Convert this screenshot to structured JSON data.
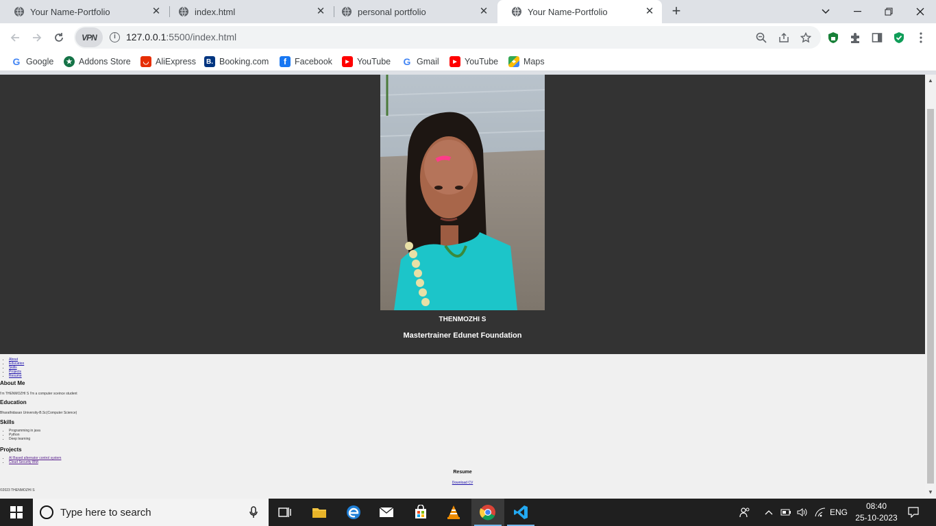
{
  "tabs": [
    {
      "title": "Your Name-Portfolio",
      "active": false
    },
    {
      "title": "index.html",
      "active": false
    },
    {
      "title": "personal portfolio",
      "active": false
    },
    {
      "title": "Your Name-Portfolio",
      "active": true
    }
  ],
  "omnibox": {
    "vpn_label": "VPN",
    "url_host": "127.0.0.1",
    "url_path": ":5500/index.html"
  },
  "bookmarks": [
    {
      "label": "Google",
      "icon": "google-icon"
    },
    {
      "label": "Addons Store",
      "icon": "addons-store-icon"
    },
    {
      "label": "AliExpress",
      "icon": "aliexpress-icon"
    },
    {
      "label": "Booking.com",
      "icon": "booking-icon"
    },
    {
      "label": "Facebook",
      "icon": "facebook-icon"
    },
    {
      "label": "YouTube",
      "icon": "youtube-icon"
    },
    {
      "label": "Gmail",
      "icon": "google-icon"
    },
    {
      "label": "YouTube",
      "icon": "youtube-icon"
    },
    {
      "label": "Maps",
      "icon": "maps-icon"
    }
  ],
  "hero": {
    "name": "THENMOZHI S",
    "subtitle": "Mastertrainer Edunet Foundation"
  },
  "nav": [
    "About",
    "Education",
    "Skills",
    "Projects",
    "Resume"
  ],
  "about": {
    "heading": "About Me",
    "text": "I'm THENMOZHI S I'm a computer sceince student"
  },
  "education": {
    "heading": "Education",
    "text": "Bharathidasan University-B.Sc(Computer Science)"
  },
  "skills": {
    "heading": "Skills",
    "items": [
      "Programming in java",
      "Python",
      "Deep learning"
    ]
  },
  "projects": {
    "heading": "Projects",
    "items": [
      "AI Based alternator control system",
      "Cloud Security IBM"
    ]
  },
  "resume": {
    "heading": "Resume",
    "link": "Download CV"
  },
  "footer": "©2023 THENMOZHI S",
  "taskbar": {
    "search_placeholder": "Type here to search",
    "language": "ENG",
    "time": "08:40",
    "date": "25-10-2023"
  },
  "colors": {
    "hero_bg": "#333333",
    "page_bg": "#f0f0f0",
    "link": "#1a0dab",
    "visited_link": "#551a8b"
  }
}
